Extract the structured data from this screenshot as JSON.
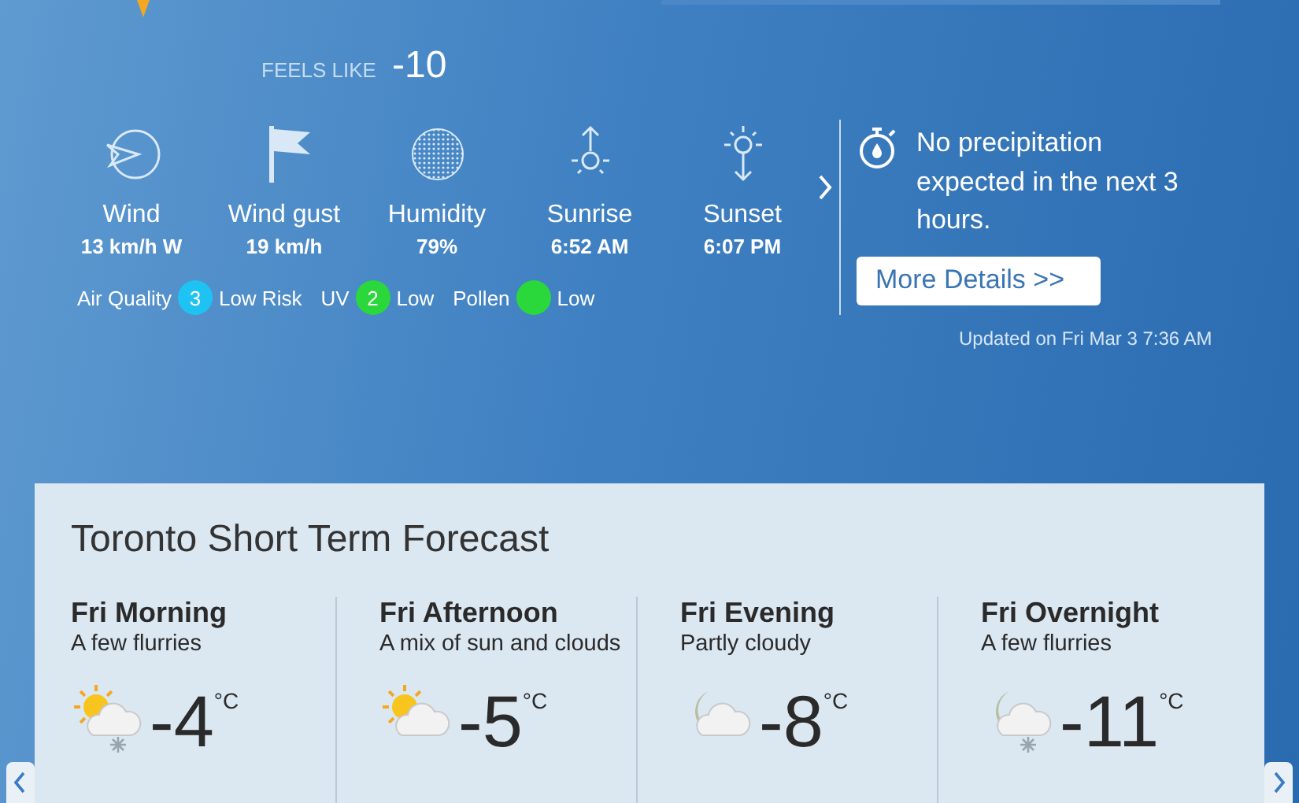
{
  "feels_like": {
    "label": "FEELS LIKE",
    "value": "-10"
  },
  "conditions": [
    {
      "kind": "wind",
      "label": "Wind",
      "value": "13 km/h W"
    },
    {
      "kind": "gust",
      "label": "Wind gust",
      "value": "19 km/h"
    },
    {
      "kind": "humidity",
      "label": "Humidity",
      "value": "79%"
    },
    {
      "kind": "sunrise",
      "label": "Sunrise",
      "value": "6:52 AM"
    },
    {
      "kind": "sunset",
      "label": "Sunset",
      "value": "6:07 PM"
    }
  ],
  "indices": [
    {
      "label": "Air Quality",
      "badge": "3",
      "color": "#1fc3f3",
      "rating": "Low Risk"
    },
    {
      "label": "UV",
      "badge": "2",
      "color": "#2ad83c",
      "rating": "Low"
    },
    {
      "label": "Pollen",
      "color": "#2ad83c",
      "rating": "Low"
    }
  ],
  "precipitation": {
    "message": "No precipitation expected in the next 3 hours.",
    "button": "More Details >>",
    "updated": "Updated on Fri Mar 3 7:36 AM"
  },
  "forecast": {
    "title": "Toronto Short Term Forecast",
    "periods": [
      {
        "name": "Fri Morning",
        "summary": "A few flurries",
        "kind": "sun-snow",
        "temp": "-4",
        "unit": "°C"
      },
      {
        "name": "Fri Afternoon",
        "summary": "A mix of sun and clouds",
        "kind": "sun",
        "temp": "-5",
        "unit": "°C"
      },
      {
        "name": "Fri Evening",
        "summary": "Partly cloudy",
        "kind": "moon",
        "temp": "-8",
        "unit": "°C"
      },
      {
        "name": "Fri Overnight",
        "summary": "A few flurries",
        "kind": "moon-snow",
        "temp": "-11",
        "unit": "°C"
      }
    ]
  }
}
